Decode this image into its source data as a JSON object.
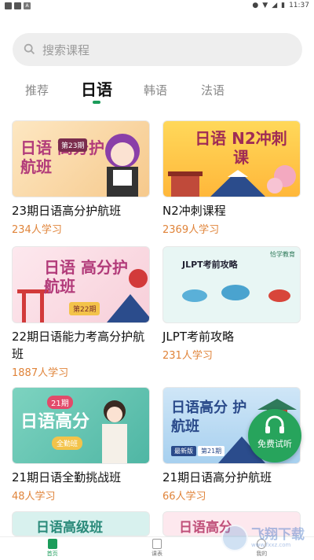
{
  "status": {
    "time": "11:37"
  },
  "search": {
    "placeholder": "搜索课程"
  },
  "tabs": [
    {
      "label": "推荐",
      "active": false
    },
    {
      "label": "日语",
      "active": true
    },
    {
      "label": "韩语",
      "active": false
    },
    {
      "label": "法语",
      "active": false
    }
  ],
  "courses": [
    {
      "thumb_title": "日语 高分护航班",
      "thumb_badge": "第23期",
      "name": "23期日语高分护航班",
      "learners": "234人学习"
    },
    {
      "thumb_title": "日语 N2冲刺课",
      "name": "N2冲刺课程",
      "learners": "2369人学习"
    },
    {
      "thumb_title": "日语 高分护航班",
      "thumb_badge": "第22期",
      "name": "22期日语能力考高分护航班",
      "learners": "1887人学习"
    },
    {
      "thumb_title": "JLPT考前攻略",
      "thumb_brand": "恰学教育",
      "name": "JLPT考前攻略",
      "learners": "231人学习"
    },
    {
      "thumb_title": "日语高分",
      "thumb_badge": "全勤班",
      "thumb_issue": "21期",
      "name": "21期日语全勤挑战班",
      "learners": "48人学习"
    },
    {
      "thumb_title": "日语高分 护航班",
      "thumb_badge": "第21期",
      "thumb_tag": "最新版",
      "name": "21期日语高分护航班",
      "learners": "66人学习"
    },
    {
      "thumb_title": "日语高级班"
    },
    {
      "thumb_title": "日语高分"
    }
  ],
  "floating_button": {
    "label": "免费试听"
  },
  "tabbar": [
    {
      "label": "首页",
      "active": true
    },
    {
      "label": "课表",
      "active": false
    },
    {
      "label": "我的",
      "active": false
    }
  ],
  "watermark": {
    "text": "飞翔下载",
    "sub": "www.fxxz.com"
  },
  "colors": {
    "accent": "#1b9c5a",
    "count": "#e0843a",
    "float": "#27a45c"
  }
}
